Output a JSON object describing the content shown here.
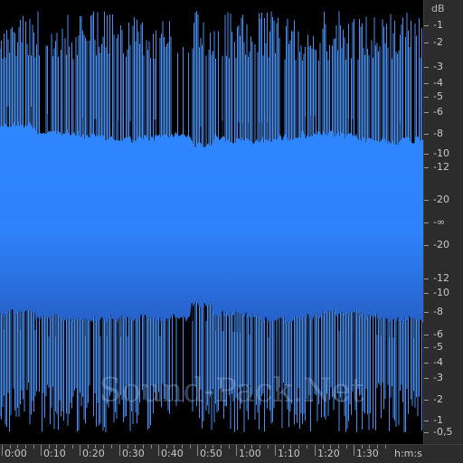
{
  "waveform": {
    "color": "#2f83ff",
    "peak_color": "#4a8ff0",
    "background": "#000000",
    "description_visible": false
  },
  "db_scale": {
    "unit": "dB",
    "labels": [
      "-1",
      "-2",
      "-3",
      "-4",
      "-5",
      "-6",
      "-8",
      "-10",
      "-12",
      "-20",
      "-∞",
      "-20",
      "-12",
      "-10",
      "-8",
      "-6",
      "-5",
      "-4",
      "-3",
      "-2",
      "-1",
      "-0,5"
    ]
  },
  "time_ruler": {
    "unit": "h:m:s",
    "labels": [
      "0:00",
      "0:10",
      "0:20",
      "0:30",
      "0:40",
      "0:50",
      "1:00",
      "1:10",
      "1:20",
      "1:30"
    ]
  },
  "watermark": "Sound-Pack.Net"
}
